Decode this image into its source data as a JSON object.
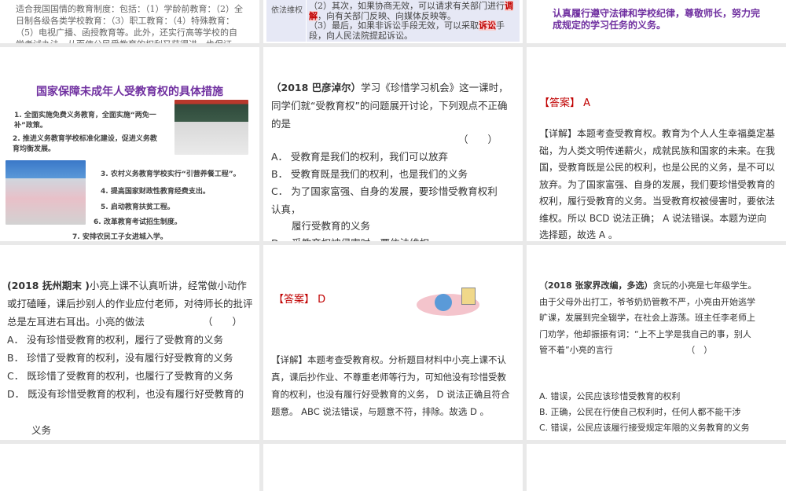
{
  "slides": [
    {
      "id": 1,
      "text": "适合我国国情的教育制度：包括：（1）学龄前教育：（2）全日制各级各类学校教育：（3）职工教育：（4）特殊教育：（5）电视广播、函授教育等。此外，还实行高等学校的自学考试办法，从而使公民受教育的权利又获得进一步保证。"
    },
    {
      "id": 2,
      "label": "依法维权",
      "line2a": "（2）其次，如果协商无效，可以请求有关部门进行",
      "hl1": "调解",
      "line2b": "，向有关部门反映、向媒体反映等。",
      "line3a": "（3）最后，如果非诉讼手段无效，可以采取",
      "hl2": "诉讼",
      "line3b": "手段，向人民法院提起诉讼。"
    },
    {
      "id": 3,
      "text": "认真履行遵守法律和学校纪律，尊敬师长，努力完成规定的学习任务的义务。"
    },
    {
      "id": 4,
      "title": "国家保障未成年人受教育权的具体措施",
      "items": [
        "1. 全面实施免费义务教育，全面实施“两免一补”政策。",
        "2. 推进义务教育学校标准化建设，促进义务教育均衡发展。",
        "3. 农村义务教育学校实行“引营养餐工程”。",
        "4. 提高国家财政性教育经费支出。",
        "5. 启动教育扶贫工程。",
        "6. 改革教育考试招生制度。",
        "7. 安排农民工子女进城入学。"
      ]
    },
    {
      "id": 5,
      "source": "（2018 巴彦淖尔）",
      "stem": "学习《珍惜学习机会》这一课时，同学们就“受教育权”的问题展开讨论，下列观点不正确的是",
      "paren": "（　　）",
      "options": [
        "A．  受教育是我们的权利，我们可以放弃",
        "B．  受教育既是我们的权利，也是我们的义务",
        "C．  为了国家富强、自身的发展，要珍惜受教育权利认真，",
        "履行受教育的义务",
        "D．  受教育权被侵害时，要依法维权"
      ]
    },
    {
      "id": 6,
      "answer": "【答案】 A",
      "detail": "【详解】本题考查受教育权。教育为个人人生幸福奠定基础，为人类文明传递薪火，成就民族和国家的未来。在我国，受教育既是公民的权利，也是公民的义务，是不可以放弃。为了国家富强、自身的发展，我们要珍惜受教育的权利，履行受教育的义务。当受教育权被侵害时，要依法维权。所以 BCD 说法正确； A 说法错误。本题为逆向选择题，故选 A 。"
    },
    {
      "id": 7,
      "source": "(2018 抚州期末 )",
      "stem": "小亮上课不认真听讲，经常做小动作或打磕睡，课后抄别人的作业应付老师，对待师长的批评总是左耳进右耳出。小亮的做法",
      "paren": "（　　）",
      "options": [
        "A．  没有珍惜受教育的权利，履行了受教育的义务",
        "B．  珍惜了受教育的权利，没有履行好受教育的义务",
        "C．  既珍惜了受教育的权利，也履行了受教育的义务",
        "D．  既没有珍惜受教育的权利，也没有履行好受教育的",
        "义务"
      ]
    },
    {
      "id": 8,
      "answer": "【答案】 D",
      "detail": "【详解】本题考查受教育权。分析题目材料中小亮上课不认真，课后抄作业、不尊重老师等行为，可知他没有珍惜受教育的权利，也没有履行好受教育的义务， D 说法正确且符合题意。 ABC 说法错误，与题意不符，排除。故选 D 。"
    },
    {
      "id": 9,
      "source": "（2018 张家界改编，多选）",
      "stem": "贪玩的小亮是七年级学生。由于父母外出打工，爷爷奶奶管教不严，小亮由开始逃学旷课，发展到完全辍学，在社会上游荡。班主任李老师上门劝学，他却振振有词：“上不上学是我自己的事，别人管不着”小亮的言行　　　　　　　　　（　）",
      "options": [
        "A. 错误，公民应该珍惜受教育的权利",
        "B. 正确，公民在行使自己权利时，任何人都不能干涉",
        "C. 错误，公民应该履行接受规定年限的义务教育的义务"
      ]
    }
  ]
}
